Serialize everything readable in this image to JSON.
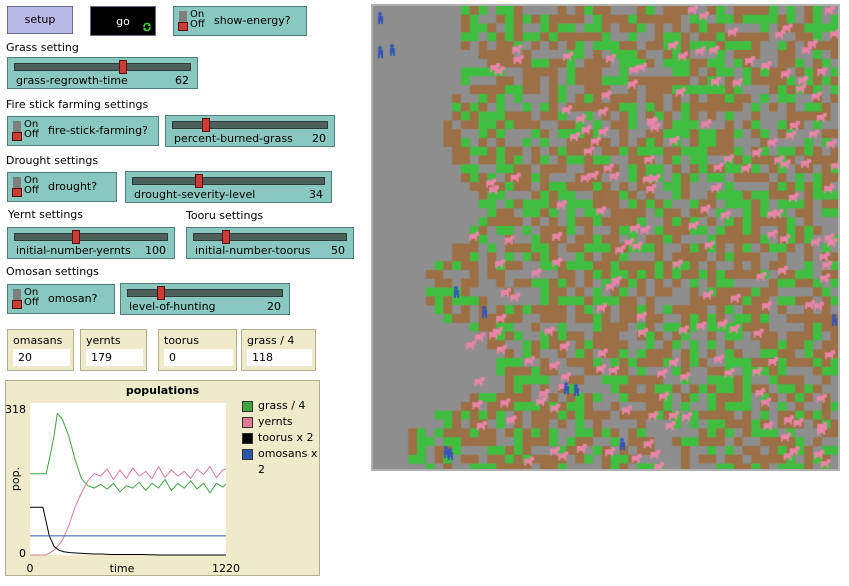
{
  "buttons": {
    "setup": "setup",
    "go": "go"
  },
  "switches": {
    "show_energy": {
      "label": "show-energy?",
      "on": "On",
      "off": "Off",
      "state": "off"
    },
    "fire_stick_farming": {
      "label": "fire-stick-farming?",
      "on": "On",
      "off": "Off",
      "state": "off"
    },
    "drought": {
      "label": "drought?",
      "on": "On",
      "off": "Off",
      "state": "off"
    },
    "omosan": {
      "label": "omosan?",
      "on": "On",
      "off": "Off",
      "state": "off"
    }
  },
  "sections": {
    "grass": "Grass setting",
    "fire": "Fire stick farming settings",
    "drought": "Drought settings",
    "yernt": "Yernt settings",
    "tooru": "Tooru settings",
    "omosan": "Omosan settings"
  },
  "sliders": {
    "grass_regrowth_time": {
      "label": "grass-regrowth-time",
      "value": "62",
      "fraction": 0.62
    },
    "percent_burned_grass": {
      "label": "percent-burned-grass",
      "value": "20",
      "fraction": 0.2
    },
    "drought_severity_level": {
      "label": "drought-severity-level",
      "value": "34",
      "fraction": 0.34
    },
    "initial_number_yernts": {
      "label": "initial-number-yernts",
      "value": "100",
      "fraction": 0.4
    },
    "initial_number_toorus": {
      "label": "initial-number-toorus",
      "value": "50",
      "fraction": 0.2
    },
    "level_of_hunting": {
      "label": "level-of-hunting",
      "value": "20",
      "fraction": 0.2
    }
  },
  "monitors": [
    {
      "label": "omasans",
      "value": "20"
    },
    {
      "label": "yernts",
      "value": "179"
    },
    {
      "label": "toorus",
      "value": "0"
    },
    {
      "label": "grass / 4",
      "value": "118"
    }
  ],
  "chart_data": {
    "type": "line",
    "title": "populations",
    "xlabel": "time",
    "ylabel": "pop.",
    "xlim": [
      0,
      1220
    ],
    "ylim": [
      0,
      318
    ],
    "x_tick_labels": [
      "0",
      "1220"
    ],
    "y_tick_labels": [
      "0",
      "318"
    ],
    "series": [
      {
        "name": "grass / 4",
        "color": "#3fa53f",
        "x": [
          0,
          60,
          100,
          130,
          150,
          170,
          200,
          240,
          280,
          320,
          360,
          400,
          440,
          480,
          520,
          560,
          600,
          640,
          680,
          720,
          760,
          800,
          840,
          880,
          920,
          960,
          1000,
          1040,
          1080,
          1120,
          1160,
          1200,
          1220
        ],
        "y": [
          170,
          170,
          170,
          215,
          250,
          296,
          285,
          250,
          200,
          160,
          145,
          140,
          148,
          138,
          150,
          132,
          145,
          140,
          152,
          135,
          150,
          140,
          158,
          135,
          150,
          140,
          155,
          138,
          150,
          130,
          150,
          142,
          148
        ]
      },
      {
        "name": "yernts",
        "color": "#e07b96",
        "x": [
          0,
          100,
          150,
          200,
          240,
          280,
          320,
          360,
          400,
          440,
          480,
          520,
          560,
          600,
          640,
          680,
          720,
          760,
          800,
          840,
          880,
          920,
          960,
          1000,
          1040,
          1080,
          1120,
          1160,
          1200,
          1220
        ],
        "y": [
          0,
          0,
          10,
          30,
          60,
          100,
          130,
          155,
          170,
          165,
          180,
          158,
          178,
          160,
          182,
          165,
          175,
          160,
          185,
          162,
          178,
          165,
          175,
          160,
          180,
          168,
          185,
          162,
          178,
          180
        ]
      },
      {
        "name": "toorus x 2",
        "color": "#000000",
        "x": [
          0,
          40,
          80,
          100,
          120,
          150,
          180,
          210,
          250,
          300,
          350,
          400,
          450,
          500,
          600,
          700,
          800,
          900,
          1000,
          1100,
          1220
        ],
        "y": [
          100,
          100,
          100,
          70,
          40,
          18,
          10,
          7,
          5,
          4,
          3,
          2,
          2,
          1,
          1,
          1,
          0,
          0,
          0,
          0,
          0
        ]
      },
      {
        "name": "omosans x 2",
        "color": "#2e56a8",
        "x": [
          0,
          1220
        ],
        "y": [
          40,
          40
        ]
      }
    ]
  },
  "world": {
    "colors": {
      "grass": "#3fbf3f",
      "dirt": "#9c6f44",
      "gray": "#8e8e8e",
      "yernt": "#e885a8",
      "omosan": "#3356b8"
    }
  }
}
